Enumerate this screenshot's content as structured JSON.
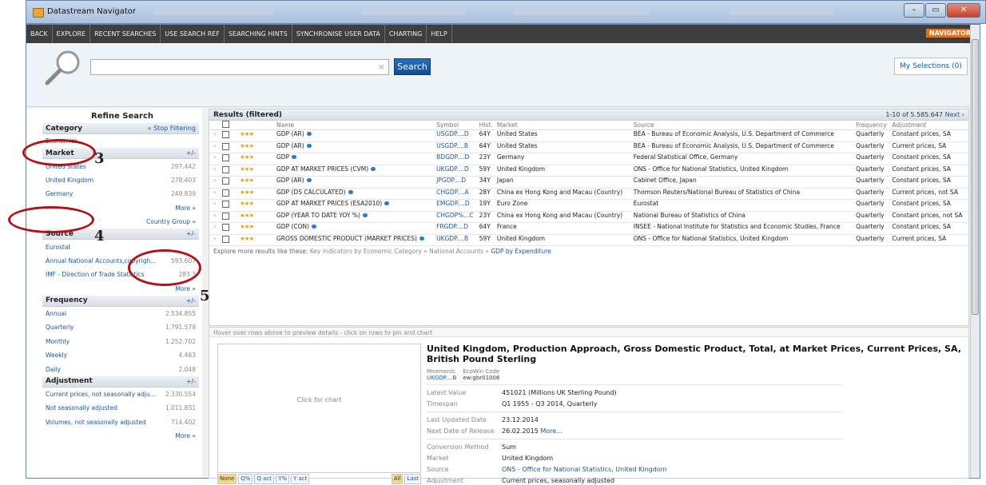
{
  "window": {
    "title": "Datastream Navigator"
  },
  "menu": {
    "items": [
      "BACK",
      "EXPLORE",
      "RECENT SEARCHES",
      "USE SEARCH REF",
      "SEARCHING HINTS",
      "SYNCHRONISE USER DATA",
      "CHARTING",
      "HELP"
    ],
    "brand": "NAVIGATOR"
  },
  "search": {
    "value": "",
    "button": "Search",
    "my_selections": "My Selections (0)"
  },
  "refine": {
    "title": "Refine Search",
    "category": {
      "title": "Category",
      "action": "« Stop Filtering",
      "value": "Economics"
    },
    "market": {
      "title": "Market",
      "action": "+/-",
      "items": [
        {
          "label": "United States",
          "count": "297.442"
        },
        {
          "label": "United Kingdom",
          "count": "278.403"
        },
        {
          "label": "Germany",
          "count": "249.839"
        }
      ],
      "more": "More »",
      "group": "Country Group »"
    },
    "source": {
      "title": "Source",
      "action": "+/-",
      "items": [
        {
          "label": "Eurostat",
          "count": ""
        },
        {
          "label": "Annual National Accounts,copyrigh...",
          "count": "593.607"
        },
        {
          "label": "IMF - Direction of Trade Statistics",
          "count": "283.3"
        }
      ],
      "more": "More »"
    },
    "frequency": {
      "title": "Frequency",
      "action": "+/-",
      "items": [
        {
          "label": "Annual",
          "count": "2.534.855"
        },
        {
          "label": "Quarterly",
          "count": "1.791.579"
        },
        {
          "label": "Monthly",
          "count": "1.252.702"
        },
        {
          "label": "Weekly",
          "count": "4.463"
        },
        {
          "label": "Daily",
          "count": "2.048"
        }
      ]
    },
    "adjustment": {
      "title": "Adjustment",
      "action": "+/-",
      "items": [
        {
          "label": "Current prices, not seasonally adju...",
          "count": "2.330.554"
        },
        {
          "label": "Not seasonally adjusted",
          "count": "1.011.831"
        },
        {
          "label": "Volumes, not seasonally adjusted",
          "count": "714.402"
        }
      ],
      "more": "More »"
    }
  },
  "results": {
    "title": "Results (filtered)",
    "paging": "1-10 of 5.585.647",
    "next": "Next ›",
    "columns": [
      "Name",
      "Symbol",
      "Hist.",
      "Market",
      "Source",
      "Frequency",
      "Adjustment"
    ],
    "rows": [
      {
        "name": "GDP (AR)",
        "symbol": "USGDP....D",
        "hist": "64Y",
        "market": "United States",
        "source": "BEA - Bureau of Economic Analysis, U.S. Department of Commerce",
        "freq": "Quarterly",
        "adj": "Constant prices, SA"
      },
      {
        "name": "GDP (AR)",
        "symbol": "USGDP....B",
        "hist": "64Y",
        "market": "United States",
        "source": "BEA - Bureau of Economic Analysis, U.S. Department of Commerce",
        "freq": "Quarterly",
        "adj": "Current prices, SA"
      },
      {
        "name": "GDP",
        "symbol": "BDGDP....D",
        "hist": "23Y",
        "market": "Germany",
        "source": "Federal Statistical Office, Germany",
        "freq": "Quarterly",
        "adj": "Constant prices, SA"
      },
      {
        "name": "GDP AT MARKET PRICES (CVM)",
        "symbol": "UKGDP....D",
        "hist": "59Y",
        "market": "United Kingdom",
        "source": "ONS - Office for National Statistics, United Kingdom",
        "freq": "Quarterly",
        "adj": "Constant prices, SA"
      },
      {
        "name": "GDP (AR)",
        "symbol": "JPGDP....D",
        "hist": "34Y",
        "market": "Japan",
        "source": "Cabinet Office, Japan",
        "freq": "Quarterly",
        "adj": "Constant prices, SA"
      },
      {
        "name": "GDP (DS CALCULATED)",
        "symbol": "CHGDP....A",
        "hist": "28Y",
        "market": "China ex Hong Kong and Macau (Country)",
        "source": "Thomson Reuters/National Bureau of Statistics of China",
        "freq": "Quarterly",
        "adj": "Current prices, not SA"
      },
      {
        "name": "GDP AT MARKET PRICES (ESA2010)",
        "symbol": "EMGDP....D",
        "hist": "19Y",
        "market": "Euro Zone",
        "source": "Eurostat",
        "freq": "Quarterly",
        "adj": "Constant prices, SA"
      },
      {
        "name": "GDP (YEAR TO DATE YOY %)",
        "symbol": "CHGDP%...C",
        "hist": "23Y",
        "market": "China ex Hong Kong and Macau (Country)",
        "source": "National Bureau of Statistics of China",
        "freq": "Quarterly",
        "adj": "Constant prices, not SA"
      },
      {
        "name": "GDP (CON)",
        "symbol": "FRGDP....D",
        "hist": "64Y",
        "market": "France",
        "source": "INSEE - National Institute for Statistics and Economic Studies, France",
        "freq": "Quarterly",
        "adj": "Constant prices, SA"
      },
      {
        "name": "GROSS DOMESTIC PRODUCT (MARKET PRICES)",
        "symbol": "UKGDP....B",
        "hist": "59Y",
        "market": "United Kingdom",
        "source": "ONS - Office for National Statistics, United Kingdom",
        "freq": "Quarterly",
        "adj": "Current prices, SA"
      }
    ],
    "explore_prefix": "Explore more results like these:",
    "explore_path": "Key Indicators by Economic Category » National Accounts »",
    "explore_link": "GDP by Expenditure"
  },
  "preview": {
    "hint": "Hover over rows above to preview details - click on rows to pin and chart",
    "click_for_chart": "Click for chart",
    "chart_buttons": [
      "None",
      "Q%",
      "Q act",
      "Y%",
      "Y act"
    ],
    "range_buttons": [
      "All",
      "Last"
    ],
    "title": "United Kingdom, Production Approach, Gross Domestic Product, Total, at Market Prices, Current Prices, SA, British Pound Sterling",
    "mnemonic_label": "Mnemonic",
    "mnemonic": "UKGDP....B",
    "ecowin_label": "EcoWin Code",
    "ecowin": "ew:gbr01006",
    "latest_value_label": "Latest Value",
    "latest_value": "451021 (Millions UK Sterling Pound)",
    "timespan_label": "Timespan",
    "timespan": "Q1 1955 - Q3 2014, Quarterly",
    "last_updated_label": "Last Updated Date",
    "last_updated": "23.12.2014",
    "next_release_label": "Next Date of Release",
    "next_release": "26.02.2015",
    "more": "More...",
    "conversion_label": "Conversion Method",
    "conversion": "Sum",
    "market_label": "Market",
    "market": "United Kingdom",
    "source_label": "Source",
    "source": "ONS - Office for National Statistics, United Kingdom",
    "adjustment_label": "Adjustment",
    "adjustment": "Current prices, seasonally adjusted"
  },
  "annotations": [
    "3",
    "4",
    "5"
  ],
  "colors": {
    "menu_bg": "#3e3e3e",
    "brand": "#e3701b",
    "link": "#1a57a6",
    "annotation": "#b31217"
  }
}
